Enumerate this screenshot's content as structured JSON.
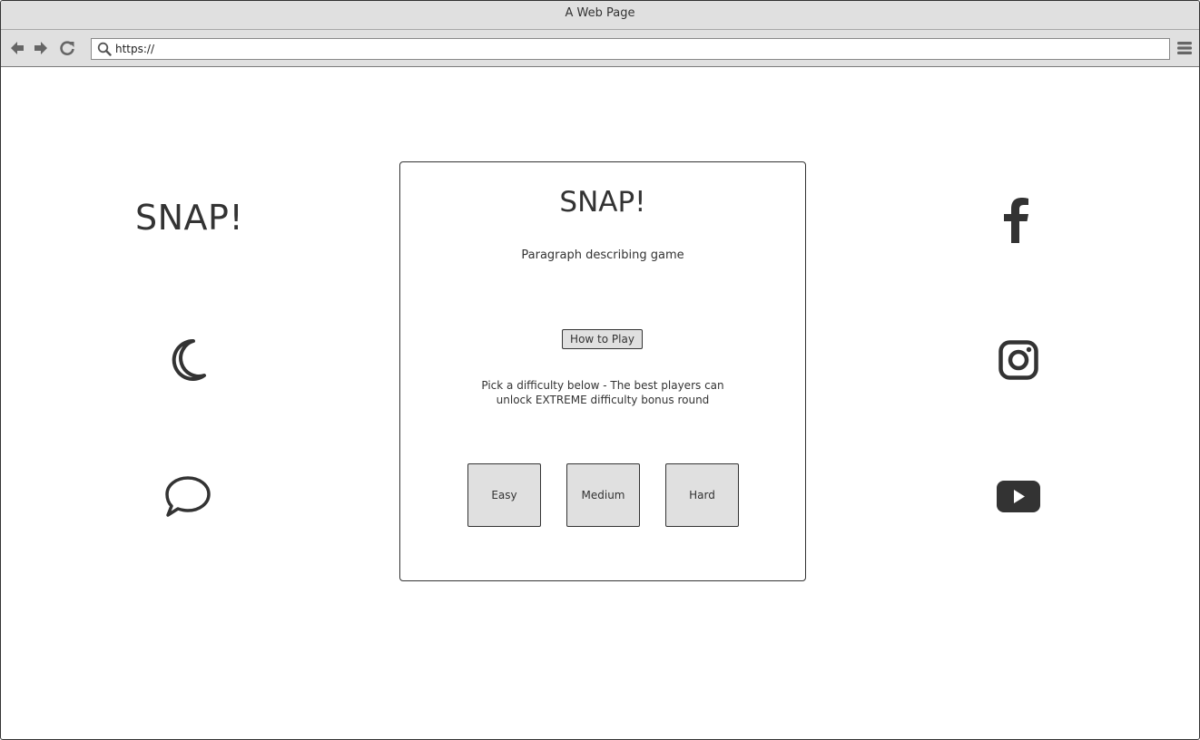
{
  "window": {
    "title": "A Web Page"
  },
  "browser": {
    "url": "https://",
    "back_icon": "arrow-left-icon",
    "forward_icon": "arrow-right-icon",
    "reload_icon": "reload-icon",
    "menu_icon": "hamburger-menu-icon",
    "search_icon": "search-icon"
  },
  "page": {
    "side_logo": "SNAP!",
    "left_icons": [
      "moon-icon",
      "speech-bubble-icon"
    ],
    "right_icons": [
      "facebook-icon",
      "instagram-icon",
      "youtube-icon"
    ],
    "card": {
      "title": "SNAP!",
      "description": "Paragraph describing game",
      "how_to_play_label": "How to Play",
      "difficulty_text_line1": "Pick a difficulty below - The best players can",
      "difficulty_text_line2": "unlock EXTREME difficulty bonus round",
      "difficulties": [
        "Easy",
        "Medium",
        "Hard"
      ]
    }
  },
  "colors": {
    "chrome": "#e0e0e0",
    "ink": "#333333",
    "button": "#e0e0e0"
  }
}
